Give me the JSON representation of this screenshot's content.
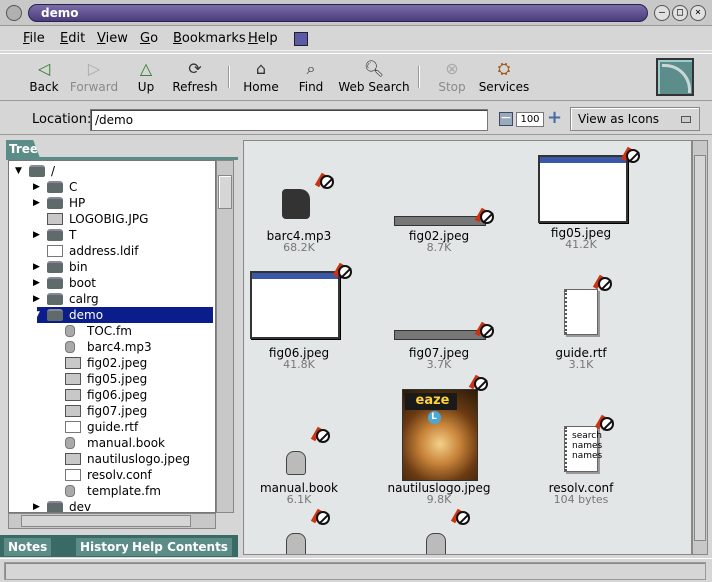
{
  "window": {
    "title": "demo"
  },
  "menu": {
    "items": [
      "File",
      "Edit",
      "View",
      "Go",
      "Bookmarks",
      "Help"
    ]
  },
  "toolbar": {
    "back": "Back",
    "forward": "Forward",
    "up": "Up",
    "refresh": "Refresh",
    "home": "Home",
    "find": "Find",
    "web_search": "Web Search",
    "stop": "Stop",
    "services": "Services"
  },
  "location": {
    "label": "Location:",
    "value": "/demo",
    "zoom": "100",
    "view_as": "View as Icons"
  },
  "tree": {
    "tab": "Tree",
    "rows": [
      {
        "label": "/",
        "icon": "folder-icon",
        "expanded": true
      },
      {
        "label": "C",
        "icon": "folder-icon",
        "expanded": false
      },
      {
        "label": "HP",
        "icon": "folder-icon",
        "expanded": false
      },
      {
        "label": "LOGOBIG.JPG",
        "icon": "image-icon",
        "expanded": null
      },
      {
        "label": "T",
        "icon": "folder-icon",
        "expanded": false
      },
      {
        "label": "address.ldif",
        "icon": "document-icon",
        "expanded": null
      },
      {
        "label": "bin",
        "icon": "folder-icon",
        "expanded": false
      },
      {
        "label": "boot",
        "icon": "folder-icon",
        "expanded": false
      },
      {
        "label": "calrg",
        "icon": "folder-icon",
        "expanded": false
      },
      {
        "label": "demo",
        "icon": "folder-icon",
        "expanded": true,
        "selected": true
      },
      {
        "label": "TOC.fm",
        "icon": "piston-icon",
        "expanded": null
      },
      {
        "label": "barc4.mp3",
        "icon": "audio-icon",
        "expanded": null
      },
      {
        "label": "fig02.jpeg",
        "icon": "image-icon",
        "expanded": null
      },
      {
        "label": "fig05.jpeg",
        "icon": "image-icon",
        "expanded": null
      },
      {
        "label": "fig06.jpeg",
        "icon": "image-icon",
        "expanded": null
      },
      {
        "label": "fig07.jpeg",
        "icon": "image-icon",
        "expanded": null
      },
      {
        "label": "guide.rtf",
        "icon": "document-icon",
        "expanded": null
      },
      {
        "label": "manual.book",
        "icon": "piston-icon",
        "expanded": null
      },
      {
        "label": "nautiluslogo.jpeg",
        "icon": "image-icon",
        "expanded": null
      },
      {
        "label": "resolv.conf",
        "icon": "document-icon",
        "expanded": null
      },
      {
        "label": "template.fm",
        "icon": "piston-icon",
        "expanded": null
      },
      {
        "label": "dev",
        "icon": "folder-icon",
        "expanded": false
      }
    ]
  },
  "sidebar_tabs": [
    "Notes",
    "History",
    "Help Contents"
  ],
  "files": [
    {
      "name": "barc4.mp3",
      "size": "68.2K",
      "kind": "audio"
    },
    {
      "name": "fig02.jpeg",
      "size": "8.7K",
      "kind": "strip"
    },
    {
      "name": "fig05.jpeg",
      "size": "41.2K",
      "kind": "screenshot"
    },
    {
      "name": "fig06.jpeg",
      "size": "41.8K",
      "kind": "screenshot"
    },
    {
      "name": "fig07.jpeg",
      "size": "3.7K",
      "kind": "strip"
    },
    {
      "name": "guide.rtf",
      "size": "3.1K",
      "kind": "page"
    },
    {
      "name": "manual.book",
      "size": "6.1K",
      "kind": "piston"
    },
    {
      "name": "nautiluslogo.jpeg",
      "size": "9.8K",
      "kind": "logo"
    },
    {
      "name": "resolv.conf",
      "size": "104 bytes",
      "kind": "text"
    },
    {
      "name": "",
      "size": "",
      "kind": "piston"
    },
    {
      "name": "",
      "size": "",
      "kind": "piston"
    }
  ],
  "resolv_preview": [
    "search",
    "names",
    "names"
  ],
  "logo_text": "eaze"
}
